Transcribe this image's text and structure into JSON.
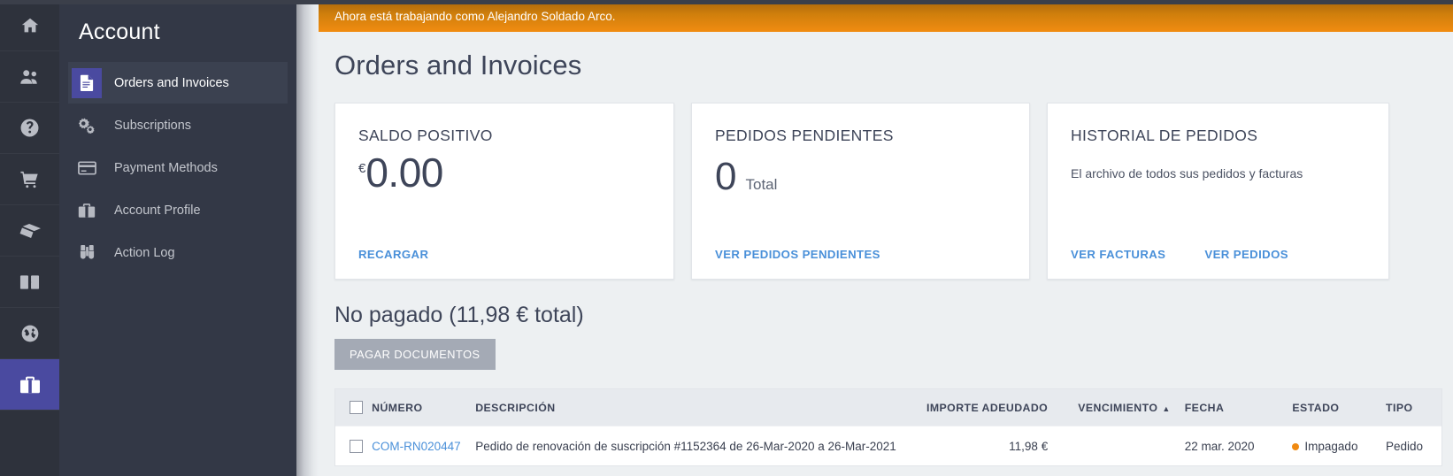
{
  "colors": {
    "accent_indigo": "#4a4aa0",
    "link_blue": "#4a90d9",
    "banner_orange": "#f18c11",
    "status_orange": "#f08a12",
    "sidebar_dark": "#333846",
    "rail_dark": "#2e323c",
    "title_navy": "#3e4559",
    "button_gray": "#a4aab5"
  },
  "icon_rail": {
    "items": [
      {
        "name": "home-icon"
      },
      {
        "name": "users-icon"
      },
      {
        "name": "help-icon"
      },
      {
        "name": "cart-icon"
      },
      {
        "name": "tag-icon"
      },
      {
        "name": "transfer-icon"
      },
      {
        "name": "globe-icon"
      },
      {
        "name": "briefcase-icon",
        "active": true
      }
    ]
  },
  "sidebar": {
    "title": "Account",
    "items": [
      {
        "label": "Orders and Invoices",
        "icon": "document-icon",
        "active": true
      },
      {
        "label": "Subscriptions",
        "icon": "gears-icon",
        "active": false
      },
      {
        "label": "Payment Methods",
        "icon": "credit-card-icon",
        "active": false
      },
      {
        "label": "Account Profile",
        "icon": "briefcase-icon",
        "active": false
      },
      {
        "label": "Action Log",
        "icon": "binoculars-icon",
        "active": false
      }
    ]
  },
  "banner": {
    "text": "Ahora está trabajando como Alejandro Soldado Arco."
  },
  "page": {
    "title": "Orders and Invoices"
  },
  "cards": [
    {
      "title": "SALDO POSITIVO",
      "currency_symbol": "€",
      "value": "0.00",
      "links": [
        {
          "label": "RECARGAR"
        }
      ]
    },
    {
      "title": "PEDIDOS PENDIENTES",
      "value": "0",
      "value_label": "Total",
      "links": [
        {
          "label": "VER PEDIDOS PENDIENTES"
        }
      ]
    },
    {
      "title": "HISTORIAL DE PEDIDOS",
      "description": "El archivo de todos sus pedidos y facturas",
      "links": [
        {
          "label": "VER FACTURAS"
        },
        {
          "label": "VER PEDIDOS"
        }
      ]
    }
  ],
  "unpaid": {
    "heading": "No pagado (11,98 € total)",
    "pay_button": "PAGAR DOCUMENTOS"
  },
  "table": {
    "columns": [
      {
        "key": "checkbox",
        "label": ""
      },
      {
        "key": "numero",
        "label": "NÚMERO"
      },
      {
        "key": "descripcion",
        "label": "DESCRIPCIÓN"
      },
      {
        "key": "importe",
        "label": "IMPORTE ADEUDADO"
      },
      {
        "key": "vencimiento",
        "label": "VENCIMIENTO",
        "sort": "asc",
        "sort_glyph": "▲"
      },
      {
        "key": "fecha",
        "label": "FECHA"
      },
      {
        "key": "estado",
        "label": "ESTADO"
      },
      {
        "key": "tipo",
        "label": "TIPO"
      }
    ],
    "rows": [
      {
        "numero": "COM-RN020447",
        "descripcion": "Pedido de renovación de suscripción #1152364 de 26-Mar-2020 a 26-Mar-2021",
        "importe": "11,98 €",
        "vencimiento": "",
        "fecha": "22 mar. 2020",
        "estado": "Impagado",
        "tipo": "Pedido"
      }
    ]
  }
}
